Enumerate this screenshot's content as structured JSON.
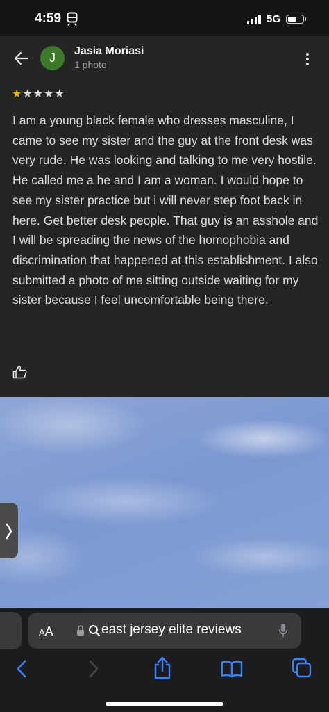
{
  "status_bar": {
    "time": "4:59",
    "network": "5G",
    "battery_level": 0.55
  },
  "review": {
    "avatar_letter": "J",
    "avatar_color": "#3d7a2a",
    "author_name": "Jasia Moriasi",
    "author_meta": "1 photo",
    "rating": 1,
    "rating_max": 5,
    "text": "I am a young black female who dresses masculine, I came to see my sister and the guy at the front desk was very rude. He was looking and talking to me very hostile. He called me a he and I am a woman. I would hope to see my sister practice but i will never step foot back in here. Get better desk people. That guy is an asshole and I will be spreading the news of the homophobia and discrimination that happened at this establishment. I also submitted a photo of me sitting outside waiting for my sister because I feel uncomfortable being there."
  },
  "browser": {
    "aa_small": "A",
    "aa_big": "A",
    "url_text": "east jersey elite reviews",
    "accent_color": "#3b82f6"
  },
  "icons": [
    "back-arrow-icon",
    "more-vertical-icon",
    "thumbs-up-icon",
    "chevron-right-icon",
    "lock-icon",
    "search-icon",
    "microphone-icon",
    "back-icon",
    "forward-icon",
    "share-icon",
    "bookmarks-icon",
    "tabs-icon",
    "train-icon"
  ]
}
